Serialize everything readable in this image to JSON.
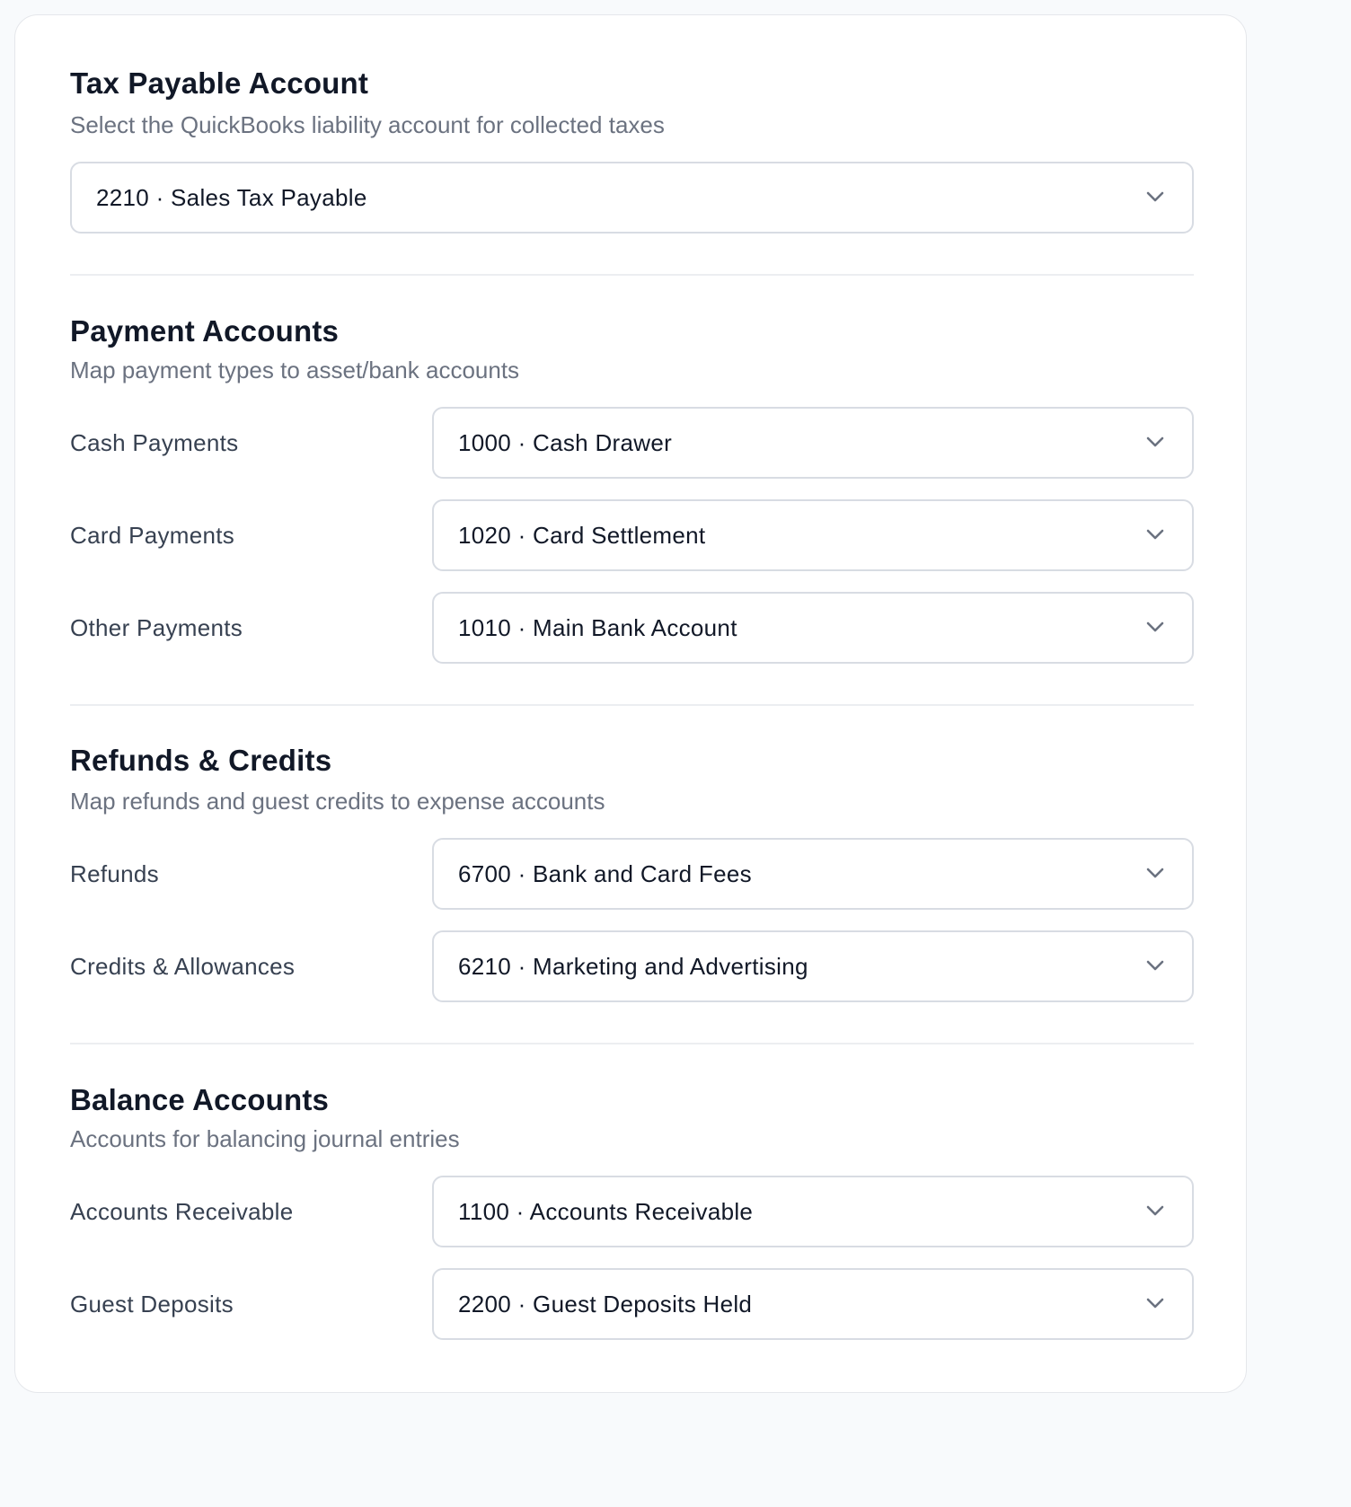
{
  "tax_section": {
    "title": "Tax Payable Account",
    "description": "Select the QuickBooks liability account for collected taxes",
    "selected": "2210 · Sales Tax Payable"
  },
  "payment_section": {
    "title": "Payment Accounts",
    "description": "Map payment types to asset/bank accounts",
    "rows": [
      {
        "label": "Cash Payments",
        "selected": "1000 · Cash Drawer"
      },
      {
        "label": "Card Payments",
        "selected": "1020 · Card Settlement"
      },
      {
        "label": "Other Payments",
        "selected": "1010 · Main Bank Account"
      }
    ]
  },
  "refunds_section": {
    "title": "Refunds & Credits",
    "description": "Map refunds and guest credits to expense accounts",
    "rows": [
      {
        "label": "Refunds",
        "selected": "6700 · Bank and Card Fees"
      },
      {
        "label": "Credits & Allowances",
        "selected": "6210 · Marketing and Advertising"
      }
    ]
  },
  "balance_section": {
    "title": "Balance Accounts",
    "description": "Accounts for balancing journal entries",
    "rows": [
      {
        "label": "Accounts Receivable",
        "selected": "1100 · Accounts Receivable"
      },
      {
        "label": "Guest Deposits",
        "selected": "2200 · Guest Deposits Held"
      }
    ]
  },
  "icons": {
    "dropdown": "chevron-down-icon"
  },
  "colors": {
    "title": "#111827",
    "muted": "#6b7280",
    "border": "#d8dce3"
  }
}
